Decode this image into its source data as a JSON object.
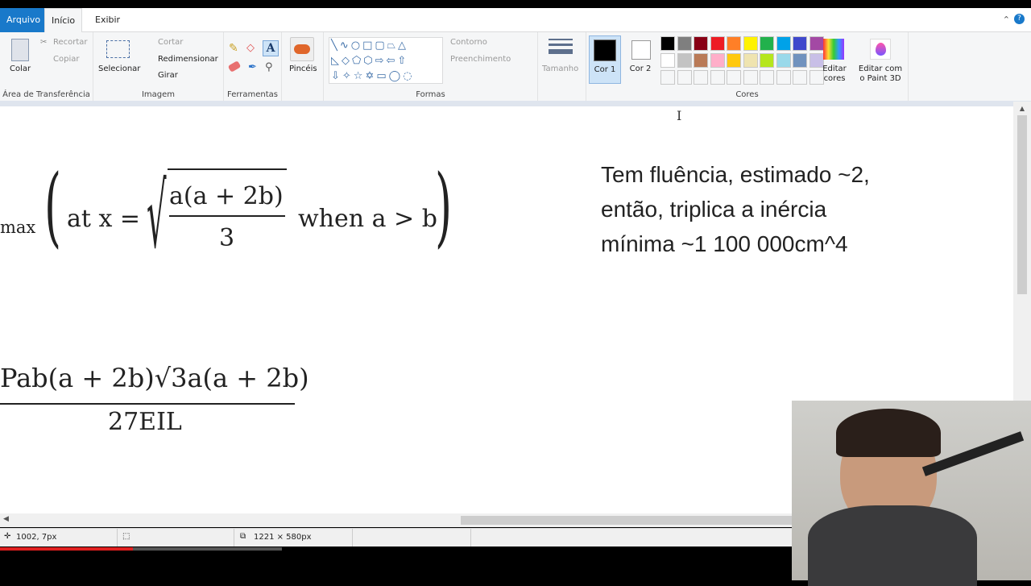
{
  "tabs": [
    "Arquivo",
    "Início",
    "Exibir"
  ],
  "clipboard": {
    "paste": "Colar",
    "cut": "Recortar",
    "copy": "Copiar",
    "label": "Área de Transferência"
  },
  "image": {
    "select": "Selecionar",
    "crop": "Cortar",
    "resize": "Redimensionar",
    "rotate": "Girar",
    "label": "Imagem"
  },
  "tools": {
    "label": "Ferramentas"
  },
  "brushes": {
    "label": "Pincéis"
  },
  "shapes": {
    "outline": "Contorno",
    "fill": "Preenchimento",
    "label": "Formas"
  },
  "size": {
    "label": "Tamanho"
  },
  "colors": {
    "color1": "Cor 1",
    "color2": "Cor 2",
    "edit": "Editar cores",
    "label": "Cores",
    "row1": [
      "#000000",
      "#7f7f7f",
      "#880015",
      "#ed1c24",
      "#ff7f27",
      "#fff200",
      "#22b14c",
      "#00a2e8",
      "#3f48cc",
      "#a349a4"
    ],
    "row2": [
      "#ffffff",
      "#c3c3c3",
      "#b97a57",
      "#ffaec9",
      "#ffc90e",
      "#efe4b0",
      "#b5e61d",
      "#99d9ea",
      "#7092be",
      "#c8bfe7"
    ]
  },
  "paint3d": {
    "label": "Editar com o Paint 3D"
  },
  "canvas": {
    "formula1": {
      "prefix": "max",
      "at": "at x =",
      "num": "a(a + 2b)",
      "den": "3",
      "cond": "when a > b"
    },
    "formula2": {
      "num": "Pab(a + 2b)√3a(a + 2b)",
      "den": "27EIL"
    },
    "note": [
      "Tem fluência, estimado ~2,",
      "então, triplica a inércia",
      "mínima ~1 100 000cm^4"
    ]
  },
  "status": {
    "cursor": "1002, 7px",
    "size": "1221 × 580px"
  }
}
